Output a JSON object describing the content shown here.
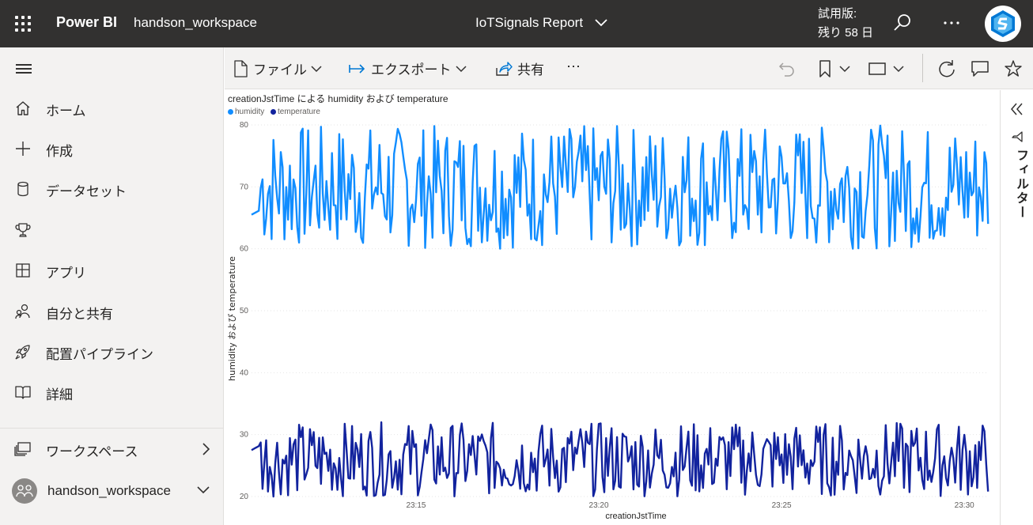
{
  "header": {
    "app_name": "Power BI",
    "workspace": "handson_workspace",
    "report_title": "IoTSignals Report",
    "trial_line1": "試用版:",
    "trial_line2": "残り 58 日"
  },
  "nav": {
    "items": [
      {
        "label": "ホーム",
        "icon": "home-icon"
      },
      {
        "label": "作成",
        "icon": "plus-icon"
      },
      {
        "label": "データセット",
        "icon": "database-icon"
      },
      {
        "label": "",
        "icon": "trophy-icon"
      },
      {
        "label": "アプリ",
        "icon": "apps-icon"
      },
      {
        "label": "自分と共有",
        "icon": "people-icon"
      },
      {
        "label": "配置パイプライン",
        "icon": "rocket-icon"
      },
      {
        "label": "詳細",
        "icon": "book-icon"
      }
    ],
    "workspaces_label": "ワークスペース",
    "current_workspace": "handson_workspace"
  },
  "commands": {
    "file": "ファイル",
    "export": "エクスポート",
    "share": "共有",
    "more": "⋯"
  },
  "filter_pane": {
    "label": "フィルター"
  },
  "colors": {
    "humidity": "#118dff",
    "temperature": "#12239e",
    "topbar": "#323130",
    "accent": "#0078d4"
  },
  "chart_data": {
    "type": "line",
    "title": "creationJstTime による humidity および temperature",
    "xlabel": "creationJstTime",
    "ylabel": "humidity および temperature",
    "ylim": [
      20,
      80
    ],
    "yticks": [
      20,
      30,
      40,
      50,
      60,
      70,
      80
    ],
    "xticks": [
      "23:15",
      "23:20",
      "23:25",
      "23:30"
    ],
    "x_range": [
      "23:10:30",
      "23:30:40"
    ],
    "grid": true,
    "legend_position": "top-left",
    "series_note": "One reading every ~3 seconds; both series oscillate irregularly throughout.",
    "series": [
      {
        "name": "humidity",
        "min": 60,
        "max": 80,
        "start": 65.5
      },
      {
        "name": "temperature",
        "min": 20,
        "max": 32,
        "start": 27.5
      }
    ]
  }
}
